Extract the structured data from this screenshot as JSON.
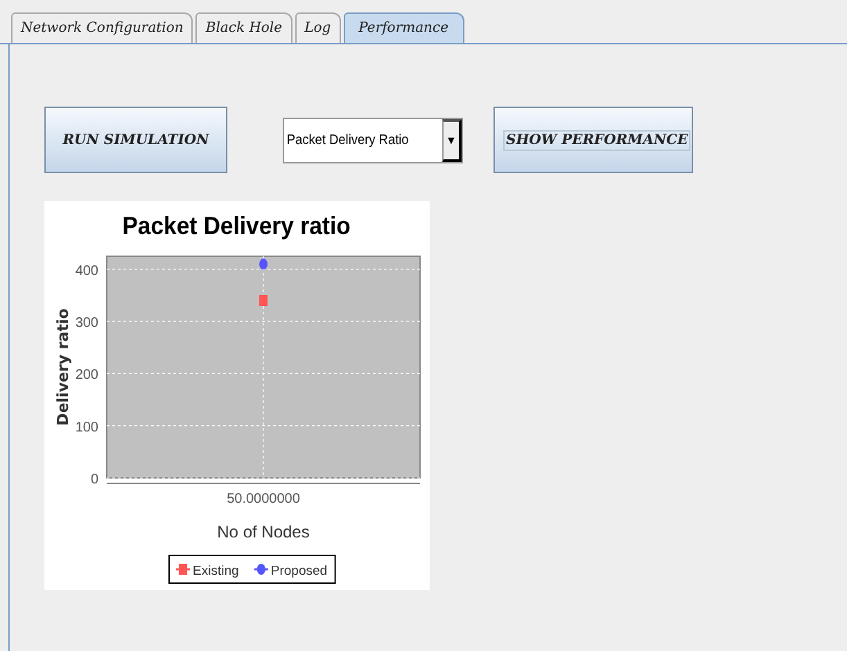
{
  "tabs": [
    {
      "label": "Network Configuration",
      "selected": false
    },
    {
      "label": "Black Hole",
      "selected": false
    },
    {
      "label": "Log",
      "selected": false
    },
    {
      "label": "Performance",
      "selected": true
    }
  ],
  "run_button": {
    "label": "RUN SIMULATION"
  },
  "metric_dropdown": {
    "value": "Packet Delivery Ratio",
    "arrow": "▼"
  },
  "show_button": {
    "label": "SHOW PERFORMANCE"
  },
  "chart": {
    "chart_data": {
      "type": "scatter",
      "grid": true,
      "legend": true,
      "title": "Packet Delivery ratio",
      "xlabel": "No of Nodes",
      "ylabel": "Delivery ratio",
      "categories": [
        "50.0000000"
      ],
      "ylim": [
        0,
        425
      ],
      "yticks": [
        0,
        100,
        200,
        300,
        400
      ],
      "series": [
        {
          "name": "Existing",
          "color": "#ff5555",
          "values": [
            340
          ],
          "marker": "square"
        },
        {
          "name": "Proposed",
          "color": "#5555ff",
          "values": [
            410
          ],
          "marker": "circle"
        }
      ]
    }
  }
}
